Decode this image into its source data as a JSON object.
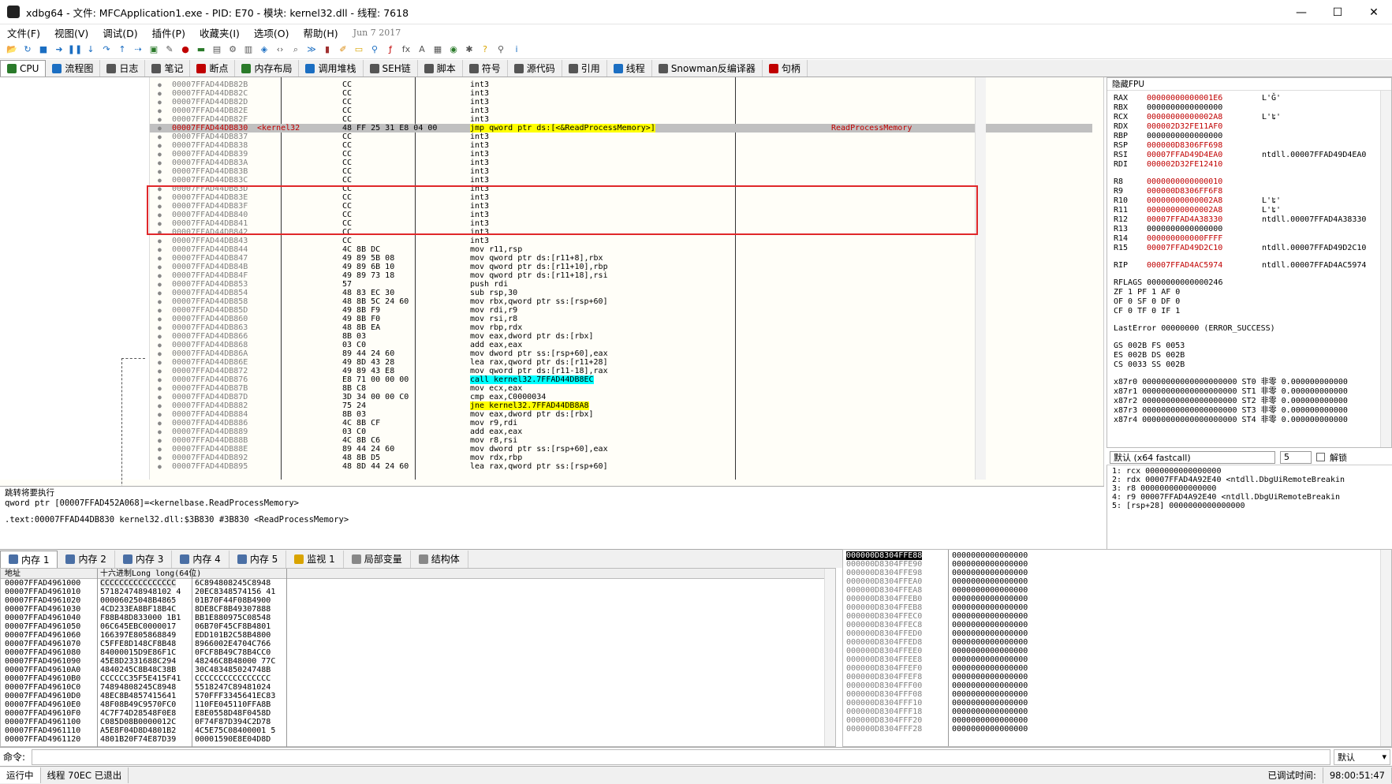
{
  "window": {
    "title": "xdbg64 - 文件: MFCApplication1.exe - PID: E70 - 模块: kernel32.dll - 线程: 7618",
    "minimize": "—",
    "maximize": "☐",
    "close": "✕"
  },
  "menu": [
    "文件(F)",
    "视图(V)",
    "调试(D)",
    "插件(P)",
    "收藏夹(I)",
    "选项(O)",
    "帮助(H)"
  ],
  "menu_date": "Jun 7 2017",
  "tabs": [
    {
      "label": "CPU",
      "icon": "cpu-icon"
    },
    {
      "label": "流程图",
      "icon": "graph-icon"
    },
    {
      "label": "日志",
      "icon": "log-icon"
    },
    {
      "label": "笔记",
      "icon": "notes-icon"
    },
    {
      "label": "断点",
      "icon": "breakpoint-icon"
    },
    {
      "label": "内存布局",
      "icon": "memory-map-icon"
    },
    {
      "label": "调用堆栈",
      "icon": "callstack-icon"
    },
    {
      "label": "SEH链",
      "icon": "seh-icon"
    },
    {
      "label": "脚本",
      "icon": "script-icon"
    },
    {
      "label": "符号",
      "icon": "symbols-icon"
    },
    {
      "label": "源代码",
      "icon": "source-icon"
    },
    {
      "label": "引用",
      "icon": "references-icon"
    },
    {
      "label": "线程",
      "icon": "threads-icon"
    },
    {
      "label": "Snowman反编译器",
      "icon": "snowman-icon"
    },
    {
      "label": "句柄",
      "icon": "handles-icon"
    }
  ],
  "disasm": {
    "selected_module_label": "<kernel32",
    "rows": [
      {
        "addr": "00007FFAD44DB82B",
        "bytes": "CC",
        "instr": "int3",
        "cmt": ""
      },
      {
        "addr": "00007FFAD44DB82C",
        "bytes": "CC",
        "instr": "int3",
        "cmt": ""
      },
      {
        "addr": "00007FFAD44DB82D",
        "bytes": "CC",
        "instr": "int3",
        "cmt": ""
      },
      {
        "addr": "00007FFAD44DB82E",
        "bytes": "CC",
        "instr": "int3",
        "cmt": ""
      },
      {
        "addr": "00007FFAD44DB82F",
        "bytes": "CC",
        "instr": "int3",
        "cmt": ""
      },
      {
        "addr": "00007FFAD44DB830",
        "bytes": "48 FF 25 31 E8 04 00",
        "instr": "jmp qword ptr ds:[<&ReadProcessMemory>]",
        "cmt": "ReadProcessMemory",
        "sel": true
      },
      {
        "addr": "00007FFAD44DB837",
        "bytes": "CC",
        "instr": "int3",
        "cmt": ""
      },
      {
        "addr": "00007FFAD44DB838",
        "bytes": "CC",
        "instr": "int3",
        "cmt": ""
      },
      {
        "addr": "00007FFAD44DB839",
        "bytes": "CC",
        "instr": "int3",
        "cmt": ""
      },
      {
        "addr": "00007FFAD44DB83A",
        "bytes": "CC",
        "instr": "int3",
        "cmt": ""
      },
      {
        "addr": "00007FFAD44DB83B",
        "bytes": "CC",
        "instr": "int3",
        "cmt": ""
      },
      {
        "addr": "00007FFAD44DB83C",
        "bytes": "CC",
        "instr": "int3",
        "cmt": ""
      },
      {
        "addr": "00007FFAD44DB83D",
        "bytes": "CC",
        "instr": "int3",
        "cmt": ""
      },
      {
        "addr": "00007FFAD44DB83E",
        "bytes": "CC",
        "instr": "int3",
        "cmt": ""
      },
      {
        "addr": "00007FFAD44DB83F",
        "bytes": "CC",
        "instr": "int3",
        "cmt": ""
      },
      {
        "addr": "00007FFAD44DB840",
        "bytes": "CC",
        "instr": "int3",
        "cmt": ""
      },
      {
        "addr": "00007FFAD44DB841",
        "bytes": "CC",
        "instr": "int3",
        "cmt": ""
      },
      {
        "addr": "00007FFAD44DB842",
        "bytes": "CC",
        "instr": "int3",
        "cmt": ""
      },
      {
        "addr": "00007FFAD44DB843",
        "bytes": "CC",
        "instr": "int3",
        "cmt": ""
      },
      {
        "addr": "00007FFAD44DB844",
        "bytes": "4C 8B DC",
        "instr": "mov r11,rsp",
        "cmt": ""
      },
      {
        "addr": "00007FFAD44DB847",
        "bytes": "49 89 5B 08",
        "instr": "mov qword ptr ds:[r11+8],rbx",
        "cmt": ""
      },
      {
        "addr": "00007FFAD44DB84B",
        "bytes": "49 89 6B 10",
        "instr": "mov qword ptr ds:[r11+10],rbp",
        "cmt": ""
      },
      {
        "addr": "00007FFAD44DB84F",
        "bytes": "49 89 73 18",
        "instr": "mov qword ptr ds:[r11+18],rsi",
        "cmt": ""
      },
      {
        "addr": "00007FFAD44DB853",
        "bytes": "57",
        "instr": "push rdi",
        "cmt": ""
      },
      {
        "addr": "00007FFAD44DB854",
        "bytes": "48 83 EC 30",
        "instr": "sub rsp,30",
        "cmt": ""
      },
      {
        "addr": "00007FFAD44DB858",
        "bytes": "48 8B 5C 24 60",
        "instr": "mov rbx,qword ptr ss:[rsp+60]",
        "cmt": ""
      },
      {
        "addr": "00007FFAD44DB85D",
        "bytes": "49 8B F9",
        "instr": "mov rdi,r9",
        "cmt": ""
      },
      {
        "addr": "00007FFAD44DB860",
        "bytes": "49 8B F0",
        "instr": "mov rsi,r8",
        "cmt": ""
      },
      {
        "addr": "00007FFAD44DB863",
        "bytes": "48 8B EA",
        "instr": "mov rbp,rdx",
        "cmt": ""
      },
      {
        "addr": "00007FFAD44DB866",
        "bytes": "8B 03",
        "instr": "mov eax,dword ptr ds:[rbx]",
        "cmt": ""
      },
      {
        "addr": "00007FFAD44DB868",
        "bytes": "03 C0",
        "instr": "add eax,eax",
        "cmt": ""
      },
      {
        "addr": "00007FFAD44DB86A",
        "bytes": "89 44 24 60",
        "instr": "mov dword ptr ss:[rsp+60],eax",
        "cmt": ""
      },
      {
        "addr": "00007FFAD44DB86E",
        "bytes": "49 8D 43 28",
        "instr": "lea rax,qword ptr ds:[r11+28]",
        "cmt": ""
      },
      {
        "addr": "00007FFAD44DB872",
        "bytes": "49 89 43 E8",
        "instr": "mov qword ptr ds:[r11-18],rax",
        "cmt": ""
      },
      {
        "addr": "00007FFAD44DB876",
        "bytes": "E8 71 00 00 00",
        "instr": "call kernel32.7FFAD44DB8EC",
        "cmt": "",
        "hl": "call"
      },
      {
        "addr": "00007FFAD44DB87B",
        "bytes": "8B C8",
        "instr": "mov ecx,eax",
        "cmt": ""
      },
      {
        "addr": "00007FFAD44DB87D",
        "bytes": "3D 34 00 00 C0",
        "instr": "cmp eax,C0000034",
        "cmt": ""
      },
      {
        "addr": "00007FFAD44DB882",
        "bytes": "75 24",
        "instr": "jne kernel32.7FFAD44DB8A8",
        "cmt": "",
        "hl": "jmp"
      },
      {
        "addr": "00007FFAD44DB884",
        "bytes": "8B 03",
        "instr": "mov eax,dword ptr ds:[rbx]",
        "cmt": ""
      },
      {
        "addr": "00007FFAD44DB886",
        "bytes": "4C 8B CF",
        "instr": "mov r9,rdi",
        "cmt": ""
      },
      {
        "addr": "00007FFAD44DB889",
        "bytes": "03 C0",
        "instr": "add eax,eax",
        "cmt": ""
      },
      {
        "addr": "00007FFAD44DB88B",
        "bytes": "4C 8B C6",
        "instr": "mov r8,rsi",
        "cmt": ""
      },
      {
        "addr": "00007FFAD44DB88E",
        "bytes": "89 44 24 60",
        "instr": "mov dword ptr ss:[rsp+60],eax",
        "cmt": ""
      },
      {
        "addr": "00007FFAD44DB892",
        "bytes": "48 8B D5",
        "instr": "mov rdx,rbp",
        "cmt": ""
      },
      {
        "addr": "00007FFAD44DB895",
        "bytes": "48 8D 44 24 60",
        "instr": "lea rax,qword ptr ss:[rsp+60]",
        "cmt": ""
      }
    ]
  },
  "info_panel": {
    "line1": "跳转将要执行",
    "line2": "qword ptr [00007FFAD452A068]=<kernelbase.ReadProcessMemory>",
    "line3": ".text:00007FFAD44DB830 kernel32.dll:$3B830 #3B830 <ReadProcessMemory>"
  },
  "registers": {
    "header": "隐藏FPU",
    "gp": [
      {
        "n": "RAX",
        "v": "00000000000001E6",
        "c": "L'Ǧ'",
        "red": true
      },
      {
        "n": "RBX",
        "v": "0000000000000000",
        "c": "",
        "red": false
      },
      {
        "n": "RCX",
        "v": "00000000000002A8",
        "c": "L'ʨ'",
        "red": true
      },
      {
        "n": "RDX",
        "v": "000002D32FE11AF0",
        "c": "",
        "red": true
      },
      {
        "n": "RBP",
        "v": "0000000000000000",
        "c": "",
        "red": false
      },
      {
        "n": "RSP",
        "v": "000000D8306FF698",
        "c": "",
        "red": true
      },
      {
        "n": "RSI",
        "v": "00007FFAD49D4EA0",
        "c": "ntdll.00007FFAD49D4EA0",
        "red": true
      },
      {
        "n": "RDI",
        "v": "000002D32FE12410",
        "c": "",
        "red": true
      }
    ],
    "ext": [
      {
        "n": "R8",
        "v": "0000000000000010",
        "c": "",
        "red": true
      },
      {
        "n": "R9",
        "v": "000000D8306FF6F8",
        "c": "",
        "red": true
      },
      {
        "n": "R10",
        "v": "00000000000002A8",
        "c": "L'ʨ'",
        "red": true
      },
      {
        "n": "R11",
        "v": "00000000000002A8",
        "c": "L'ʨ'",
        "red": true
      },
      {
        "n": "R12",
        "v": "00007FFAD4A38330",
        "c": "ntdll.00007FFAD4A38330",
        "red": true
      },
      {
        "n": "R13",
        "v": "0000000000000000",
        "c": "",
        "red": false
      },
      {
        "n": "R14",
        "v": "000000000000FFFF",
        "c": "",
        "red": true
      },
      {
        "n": "R15",
        "v": "00007FFAD49D2C10",
        "c": "ntdll.00007FFAD49D2C10",
        "red": true
      }
    ],
    "rip": {
      "n": "RIP",
      "v": "00007FFAD4AC5974",
      "c": "ntdll.00007FFAD4AC5974"
    },
    "rflags": "RFLAGS  0000000000000246",
    "flags": [
      "ZF 1  PF 1  AF 0",
      "OF 0  SF 0  DF 0",
      "CF 0  TF 0  IF 1"
    ],
    "lasterror": "LastError 00000000 (ERROR_SUCCESS)",
    "segs": [
      "GS 002B  FS 0053",
      "ES 002B  DS 002B",
      "CS 0033  SS 002B"
    ],
    "x87": [
      "x87r0 00000000000000000000 ST0 非零 0.000000000000",
      "x87r1 00000000000000000000 ST1 非零 0.000000000000",
      "x87r2 00000000000000000000 ST2 非零 0.000000000000",
      "x87r3 00000000000000000000 ST3 非零 0.000000000000",
      "x87r4 00000000000000000000 ST4 非零 0.000000000000"
    ]
  },
  "callconv": {
    "label": "默认 (x64 fastcall)",
    "count": "5",
    "unlock": "解锁"
  },
  "args": [
    "1: rcx 0000000000000000",
    "2: rdx 00007FFAD4A92E40 <ntdll.DbgUiRemoteBreakin",
    "3: r8 0000000000000000",
    "4: r9 00007FFAD4A92E40 <ntdll.DbgUiRemoteBreakin",
    "5: [rsp+28] 0000000000000000"
  ],
  "mem_tabs": [
    "内存 1",
    "内存 2",
    "内存 3",
    "内存 4",
    "内存 5",
    "监视 1",
    "局部变量",
    "结构体"
  ],
  "dump": {
    "h_addr": "地址",
    "h_hex": "十六进制Long long(64位)",
    "rows": [
      [
        "00007FFAD4961000",
        "CCCCCCCCCCCCCCCC",
        "6C894808245C8948"
      ],
      [
        "00007FFAD4961010",
        "571824748948102 4",
        "20EC8348574156 41"
      ],
      [
        "00007FFAD4961020",
        "00006025048B4865",
        "01B70F44F08B4900"
      ],
      [
        "00007FFAD4961030",
        "4CD233EA8BF18B4C",
        "8DE8CF8B49307888"
      ],
      [
        "00007FFAD4961040",
        "F88B48D833000 1B1",
        "BB1E880975C08548"
      ],
      [
        "00007FFAD4961050",
        "06C645EBC0000017",
        "06B70F45CF8B4801"
      ],
      [
        "00007FFAD4961060",
        "166397E805868849",
        "EDD101B2C58B4800"
      ],
      [
        "00007FFAD4961070",
        "C5FFE8D148CF8B48",
        "8966002E4704C766"
      ],
      [
        "00007FFAD4961080",
        "84000015D9E86F1C",
        "0FCF8B49C78B4CC0"
      ],
      [
        "00007FFAD4961090",
        "45E8D2331688C294",
        "48246C8B48000 77C"
      ],
      [
        "00007FFAD49610A0",
        "4840245C8B48C38B",
        "30C483485024748B"
      ],
      [
        "00007FFAD49610B0",
        "CCCCCC35F5E415F41",
        "CCCCCCCCCCCCCCCC"
      ],
      [
        "00007FFAD49610C0",
        "74894808245C8948",
        "5518247C89481024"
      ],
      [
        "00007FFAD49610D0",
        "48EC8B4857415641",
        "570FFF3345641EC83"
      ],
      [
        "00007FFAD49610E0",
        "48F08B49C9570FC0",
        "110FE045110FFA8B"
      ],
      [
        "00007FFAD49610F0",
        "4C7F74D28548F0E8",
        "E8E0558D48F0458D"
      ],
      [
        "00007FFAD4961100",
        "C085D08B0000012C",
        "0F74F87D394C2D78"
      ],
      [
        "00007FFAD4961110",
        "A5E8F04D8D4801B2",
        "4C5E75C08400001 5"
      ],
      [
        "00007FFAD4961120",
        "4801B20F74E87D39",
        "00001590E8E04D8D"
      ]
    ]
  },
  "stack": {
    "rows": [
      [
        "000000D8304FFE88",
        "0000000000000000"
      ],
      [
        "000000D8304FFE90",
        "0000000000000000"
      ],
      [
        "000000D8304FFE98",
        "0000000000000000"
      ],
      [
        "000000D8304FFEA0",
        "0000000000000000"
      ],
      [
        "000000D8304FFEA8",
        "0000000000000000"
      ],
      [
        "000000D8304FFEB0",
        "0000000000000000"
      ],
      [
        "000000D8304FFEB8",
        "0000000000000000"
      ],
      [
        "000000D8304FFEC0",
        "0000000000000000"
      ],
      [
        "000000D8304FFEC8",
        "0000000000000000"
      ],
      [
        "000000D8304FFED0",
        "0000000000000000"
      ],
      [
        "000000D8304FFED8",
        "0000000000000000"
      ],
      [
        "000000D8304FFEE0",
        "0000000000000000"
      ],
      [
        "000000D8304FFEE8",
        "0000000000000000"
      ],
      [
        "000000D8304FFEF0",
        "0000000000000000"
      ],
      [
        "000000D8304FFEF8",
        "0000000000000000"
      ],
      [
        "000000D8304FFF00",
        "0000000000000000"
      ],
      [
        "000000D8304FFF08",
        "0000000000000000"
      ],
      [
        "000000D8304FFF10",
        "0000000000000000"
      ],
      [
        "000000D8304FFF18",
        "0000000000000000"
      ],
      [
        "000000D8304FFF20",
        "0000000000000000"
      ],
      [
        "000000D8304FFF28",
        "0000000000000000"
      ]
    ]
  },
  "command": {
    "label": "命令:",
    "default": "默认"
  },
  "status": {
    "state": "运行中",
    "thread": "线程 70EC 已退出",
    "debug_time_label": "已调试时间:",
    "debug_time": "98:00:51:47"
  },
  "colors": {
    "accent_red": "#e0282a",
    "addr_gray": "#808080",
    "red_value": "#c00000",
    "call_highlight": "#00ffff",
    "jmp_highlight": "#ffff00"
  }
}
